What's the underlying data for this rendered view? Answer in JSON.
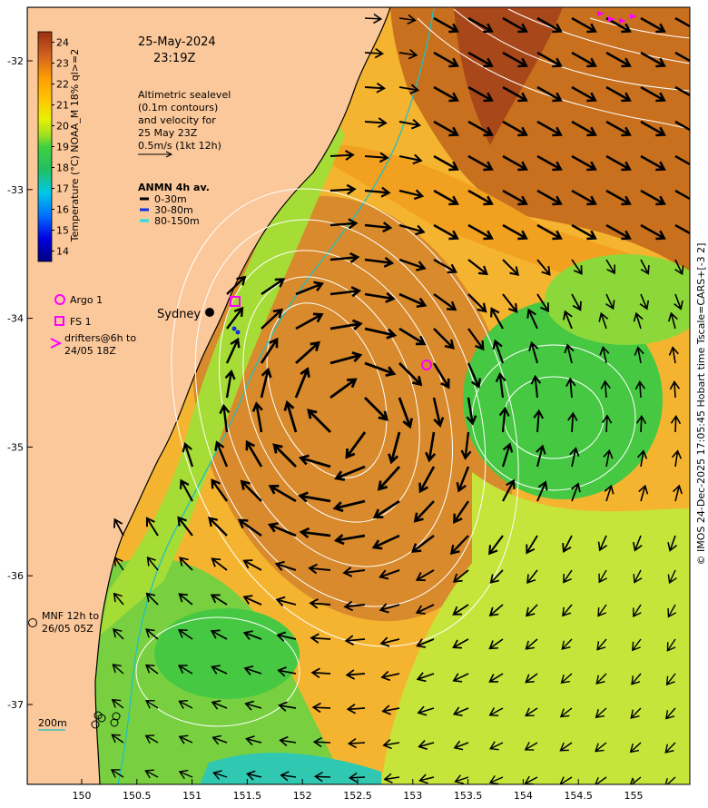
{
  "date_label": "25-May-2024",
  "time_label": "23:19Z",
  "altimetry_note": [
    "Altimetric sealevel",
    "(0.1m contours)",
    "and velocity for",
    "25 May 23Z",
    "0.5m/s (1kt 12h)"
  ],
  "anmn": {
    "title": "ANMN 4h av.",
    "items": [
      {
        "label": "0-30m",
        "color": "#000000"
      },
      {
        "label": "30-80m",
        "color": "#1030e0"
      },
      {
        "label": "80-150m",
        "color": "#20e0e0"
      }
    ]
  },
  "colorbar": {
    "label": "Temperature (°C) NOAA_M 18% ql>=2",
    "ticks": [
      "24",
      "23",
      "22",
      "21",
      "20",
      "19",
      "18",
      "17",
      "16",
      "15",
      "14"
    ],
    "min": 13.5,
    "max": 24.5
  },
  "legend": {
    "argo": "Argo 1",
    "fs": "FS 1",
    "drifters": [
      "drifters@6h to",
      "24/05 18Z"
    ],
    "mnf": [
      "MNF 12h to",
      "26/05 05Z"
    ]
  },
  "city_label": "Sydney",
  "depth_label": "200m",
  "credit": "© IMOS 24-Dec-2025 17:05:45 Hobart time Tscale=CARS+[-3 2]",
  "x_ticks": [
    "150",
    "150.5",
    "151",
    "151.5",
    "152",
    "152.5",
    "153",
    "153.5",
    "154",
    "154.5",
    "155"
  ],
  "y_ticks": [
    "-32",
    "-33",
    "-34",
    "-35",
    "-36",
    "-37"
  ],
  "colors": {
    "land": "#fbc89b",
    "warm_core": "#d88a2c",
    "shelf_green": "#3cc83c",
    "coastline": "#000000",
    "isobath_200m": "#20c0c0",
    "argo": "#ff00ff",
    "contours": "#ffffff"
  }
}
